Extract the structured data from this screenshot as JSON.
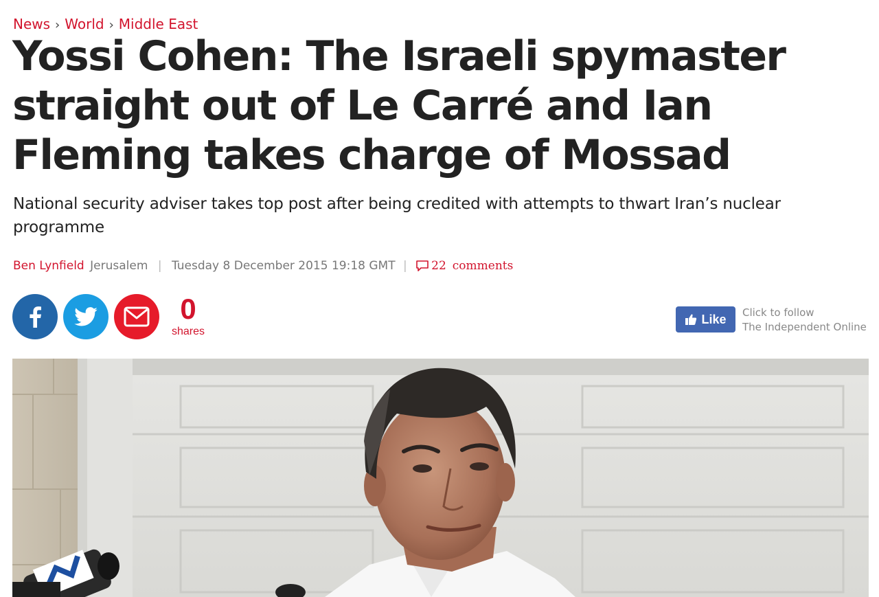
{
  "breadcrumb": {
    "items": [
      "News",
      "World",
      "Middle East"
    ],
    "separator": "›"
  },
  "article": {
    "headline": "Yossi Cohen: The Israeli spymaster straight out of Le Carré and Ian Fleming takes charge of Mossad",
    "standfirst": "National security adviser takes top post after being credited with attempts to thwart Iran’s nuclear programme",
    "author": "Ben Lynfield",
    "location": "Jerusalem",
    "dateline": "Tuesday 8 December 2015 19:18 GMT",
    "meta_divider": "|",
    "comments_count": "22",
    "comments_label": "comments"
  },
  "share": {
    "count": "0",
    "count_label": "shares",
    "buttons": [
      {
        "name": "facebook",
        "icon": "facebook-icon",
        "color": "#2366a8"
      },
      {
        "name": "twitter",
        "icon": "twitter-icon",
        "color": "#1b9de2"
      },
      {
        "name": "email",
        "icon": "envelope-icon",
        "color": "#e61b2a"
      }
    ]
  },
  "facebook_follow": {
    "like_label": "Like",
    "line1": "Click to follow",
    "line2": "The Independent Online"
  },
  "colors": {
    "accent": "#d2142d",
    "text": "#222222",
    "muted": "#777777",
    "fb_like_bg": "#4267b2"
  }
}
